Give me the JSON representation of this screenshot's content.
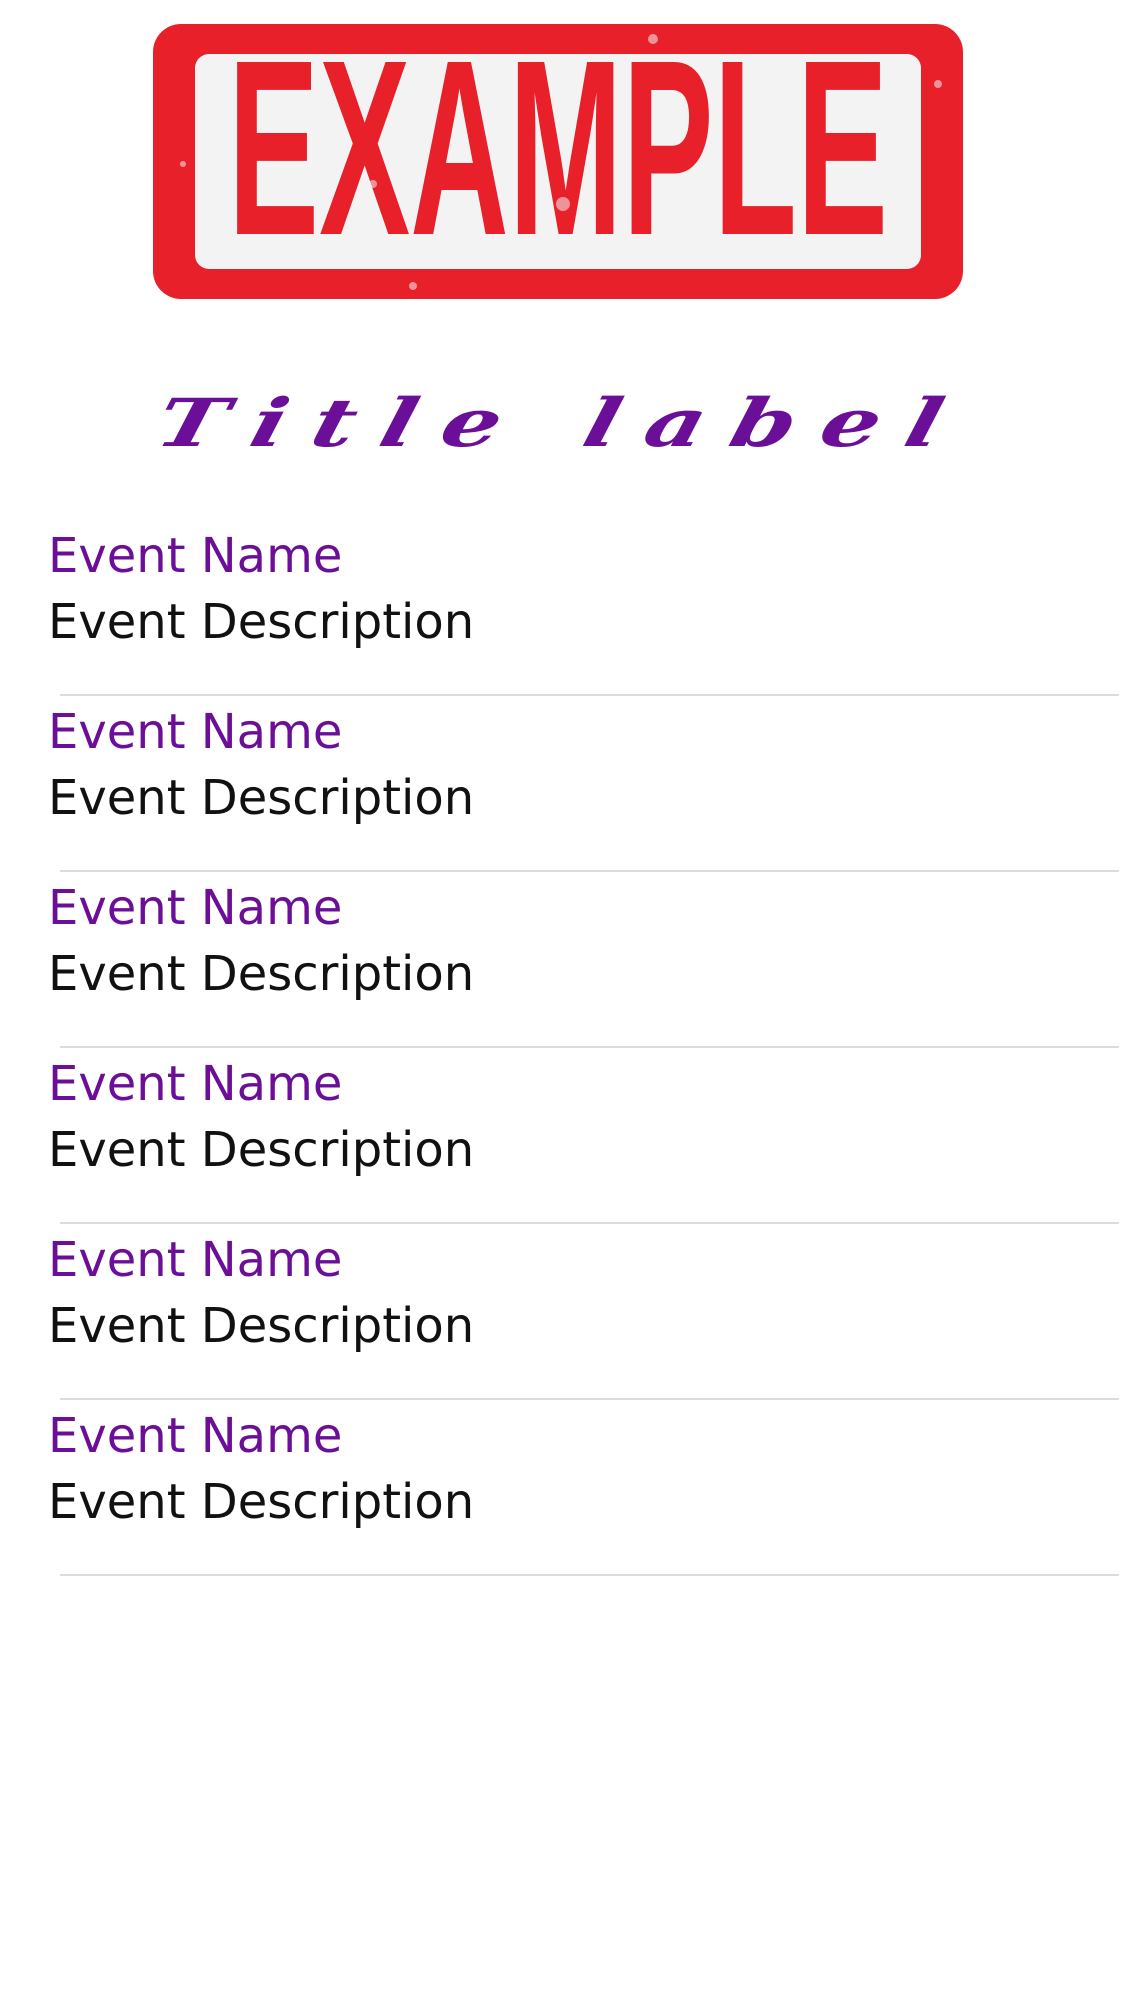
{
  "header": {
    "logo_text": "EXAMPLE",
    "logo_color": "#e8202a",
    "logo_background": "#f3f3f4"
  },
  "title": {
    "text": "Title label",
    "color": "#6c0f98"
  },
  "events": [
    {
      "name": "Event Name",
      "description": "Event Description"
    },
    {
      "name": "Event Name",
      "description": "Event Description"
    },
    {
      "name": "Event Name",
      "description": "Event Description"
    },
    {
      "name": "Event Name",
      "description": "Event Description"
    },
    {
      "name": "Event Name",
      "description": "Event Description"
    },
    {
      "name": "Event Name",
      "description": "Event Description"
    }
  ],
  "colors": {
    "accent": "#6c0f98",
    "text": "#111111",
    "separator": "#dcdcdc"
  }
}
